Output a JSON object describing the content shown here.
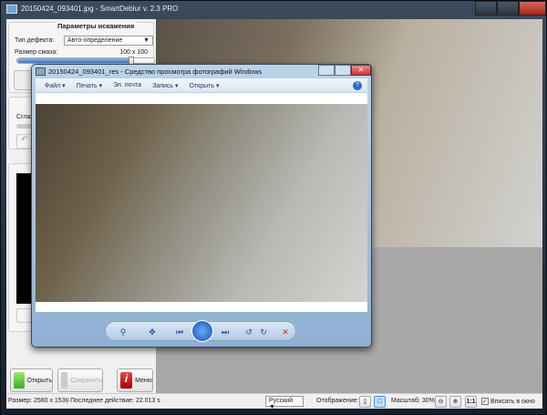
{
  "app": {
    "title": "20150424_093401.jpg - SmartDeblur v. 2.3 PRO"
  },
  "params": {
    "title": "Параметры искажения",
    "defect_label": "Тип дефекта:",
    "defect_value": "Авто-определение",
    "blur_label": "Размер смаза:",
    "blur_value": "100 x 100",
    "blur_fraction": 0.83,
    "smoothing_label": "Сглаж"
  },
  "buttons": {
    "open": "Открыть",
    "save": "Сохранить",
    "menu": "Меню"
  },
  "status": {
    "size": "Размер: 2560 x 1536",
    "last_action": "Последнее действие: 22.013 s",
    "language": "Русский",
    "display_label": "Отображение:",
    "zoom_label": "Масштаб: 30%",
    "one_to_one": "1:1",
    "fit_label": "Вписать в окно",
    "fit_checked": true
  },
  "viewer": {
    "title": "20150424_093401_res - Средство просмотра фотографий Windows",
    "menu": [
      "Файл",
      "Печать",
      "Эл. почта",
      "Запись",
      "Открыть"
    ]
  }
}
